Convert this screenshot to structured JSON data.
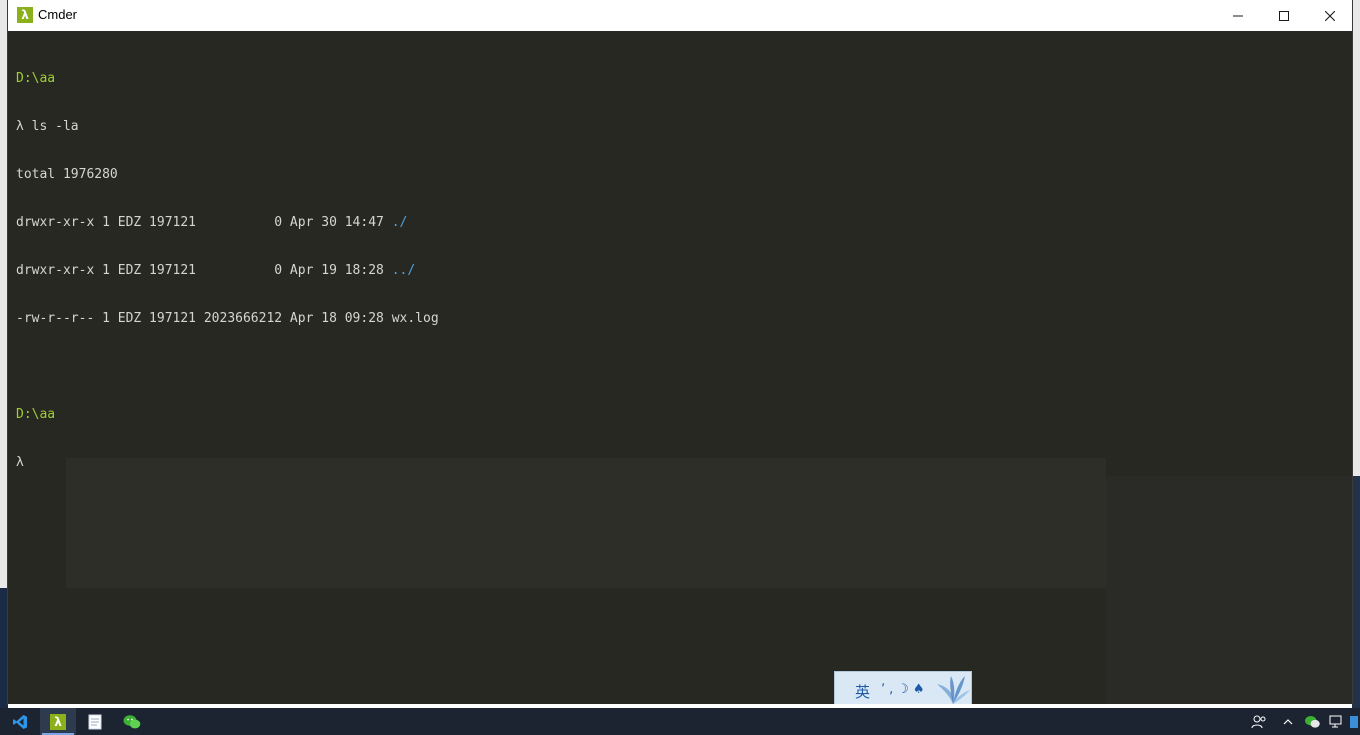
{
  "window": {
    "title": "Cmder",
    "icon": "lambda-icon",
    "controls": [
      "minimize-icon",
      "maximize-icon",
      "close-icon"
    ]
  },
  "terminal": {
    "lines": [
      {
        "type": "path",
        "text": "D:\\aa"
      },
      {
        "type": "cmd",
        "text": "λ ls -la"
      },
      {
        "type": "out",
        "text": "total 1976280"
      },
      {
        "type": "entry",
        "prefix": "drwxr-xr-x 1 EDZ 197121          0 Apr 30 14:47 ",
        "name": "./",
        "link": true
      },
      {
        "type": "entry",
        "prefix": "drwxr-xr-x 1 EDZ 197121          0 Apr 19 18:28 ",
        "name": "../",
        "link": true
      },
      {
        "type": "entry",
        "prefix": "-rw-r--r-- 1 EDZ 197121 2023666212 Apr 18 09:28 ",
        "name": "wx.log",
        "link": false
      },
      {
        "type": "blank",
        "text": ""
      },
      {
        "type": "path",
        "text": "D:\\aa"
      },
      {
        "type": "cmd",
        "text": "λ"
      }
    ]
  },
  "ime": {
    "mode_char": "英",
    "icons": [
      "punctuation-icon",
      "moon-icon",
      "skin-icon",
      "flower-icon"
    ]
  },
  "taskbar": {
    "apps": [
      "vscode-icon",
      "cmder-icon",
      "notepad-icon",
      "wechat-icon"
    ],
    "tray": [
      "people-icon",
      "chevron-up-icon",
      "wechat-tray-icon",
      "network-icon",
      "notification-icon"
    ]
  },
  "colors": {
    "terminal_bg": "#272822",
    "prompt_green": "#9ecf34",
    "link_blue": "#4da1d9",
    "taskbar_bg": "#1c2432"
  }
}
